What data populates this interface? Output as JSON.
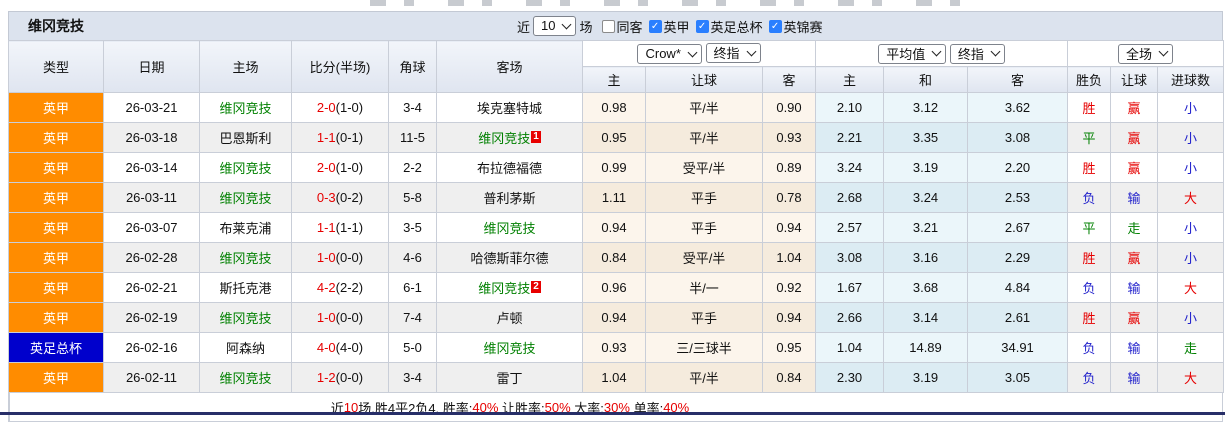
{
  "palette": {
    "league_orange": "#ff8c00",
    "cup_blue": "#0000cc",
    "team_green": "#008000",
    "red": "#e60000",
    "green": "#008000",
    "blue": "#2323cc",
    "check_blue": "#2a7fff",
    "titlebar": "#dce3ee",
    "bottom_line": "#272e68"
  },
  "header": {
    "team_title": "维冈竞技",
    "recent_prefix": "近",
    "recent_value": "10",
    "recent_suffix": "场",
    "checkboxes": [
      {
        "label": "同客",
        "checked": false
      },
      {
        "label": "英甲",
        "checked": true
      },
      {
        "label": "英足总杯",
        "checked": true
      },
      {
        "label": "英锦赛",
        "checked": true
      }
    ]
  },
  "selectors": {
    "bookmaker": "Crow*",
    "final1": "终指",
    "average": "平均值",
    "final2": "终指",
    "scope": "全场"
  },
  "columns": [
    "类型",
    "日期",
    "主场",
    "比分(半场)",
    "角球",
    "客场",
    "主",
    "让球",
    "客",
    "主",
    "和",
    "客",
    "胜负",
    "让球",
    "进球数"
  ],
  "rows": [
    {
      "league": "英甲",
      "league_color": "orange",
      "date": "26-03-21",
      "home": {
        "name": "维冈竞技",
        "highlight": true
      },
      "score": {
        "full": "2-0",
        "half": "(1-0)"
      },
      "corners": "3-4",
      "away": {
        "name": "埃克塞特城",
        "highlight": false,
        "badge": ""
      },
      "crow": {
        "home": "0.98",
        "handicap": "平/半",
        "away": "0.90"
      },
      "avg": {
        "home": "2.10",
        "draw": "3.12",
        "away": "3.62"
      },
      "outcome": {
        "text": "胜",
        "color": "red"
      },
      "handicap_outcome": {
        "text": "赢",
        "color": "red"
      },
      "goals_outcome": {
        "text": "小",
        "color": "blue"
      }
    },
    {
      "league": "英甲",
      "league_color": "orange",
      "date": "26-03-18",
      "home": {
        "name": "巴恩斯利",
        "highlight": false
      },
      "score": {
        "full": "1-1",
        "half": "(0-1)"
      },
      "corners": "11-5",
      "away": {
        "name": "维冈竞技",
        "highlight": true,
        "badge": "1"
      },
      "crow": {
        "home": "0.95",
        "handicap": "平/半",
        "away": "0.93"
      },
      "avg": {
        "home": "2.21",
        "draw": "3.35",
        "away": "3.08"
      },
      "outcome": {
        "text": "平",
        "color": "green"
      },
      "handicap_outcome": {
        "text": "赢",
        "color": "red"
      },
      "goals_outcome": {
        "text": "小",
        "color": "blue"
      }
    },
    {
      "league": "英甲",
      "league_color": "orange",
      "date": "26-03-14",
      "home": {
        "name": "维冈竞技",
        "highlight": true
      },
      "score": {
        "full": "2-0",
        "half": "(1-0)"
      },
      "corners": "2-2",
      "away": {
        "name": "布拉德福德",
        "highlight": false,
        "badge": ""
      },
      "crow": {
        "home": "0.99",
        "handicap": "受平/半",
        "away": "0.89"
      },
      "avg": {
        "home": "3.24",
        "draw": "3.19",
        "away": "2.20"
      },
      "outcome": {
        "text": "胜",
        "color": "red"
      },
      "handicap_outcome": {
        "text": "赢",
        "color": "red"
      },
      "goals_outcome": {
        "text": "小",
        "color": "blue"
      }
    },
    {
      "league": "英甲",
      "league_color": "orange",
      "date": "26-03-11",
      "home": {
        "name": "维冈竞技",
        "highlight": true
      },
      "score": {
        "full": "0-3",
        "half": "(0-2)"
      },
      "corners": "5-8",
      "away": {
        "name": "普利茅斯",
        "highlight": false,
        "badge": ""
      },
      "crow": {
        "home": "1.11",
        "handicap": "平手",
        "away": "0.78"
      },
      "avg": {
        "home": "2.68",
        "draw": "3.24",
        "away": "2.53"
      },
      "outcome": {
        "text": "负",
        "color": "blue"
      },
      "handicap_outcome": {
        "text": "输",
        "color": "blue"
      },
      "goals_outcome": {
        "text": "大",
        "color": "red"
      }
    },
    {
      "league": "英甲",
      "league_color": "orange",
      "date": "26-03-07",
      "home": {
        "name": "布莱克浦",
        "highlight": false
      },
      "score": {
        "full": "1-1",
        "half": "(1-1)"
      },
      "corners": "3-5",
      "away": {
        "name": "维冈竞技",
        "highlight": true,
        "badge": ""
      },
      "crow": {
        "home": "0.94",
        "handicap": "平手",
        "away": "0.94"
      },
      "avg": {
        "home": "2.57",
        "draw": "3.21",
        "away": "2.67"
      },
      "outcome": {
        "text": "平",
        "color": "green"
      },
      "handicap_outcome": {
        "text": "走",
        "color": "green"
      },
      "goals_outcome": {
        "text": "小",
        "color": "blue"
      }
    },
    {
      "league": "英甲",
      "league_color": "orange",
      "date": "26-02-28",
      "home": {
        "name": "维冈竞技",
        "highlight": true
      },
      "score": {
        "full": "1-0",
        "half": "(0-0)"
      },
      "corners": "4-6",
      "away": {
        "name": "哈德斯菲尔德",
        "highlight": false,
        "badge": ""
      },
      "crow": {
        "home": "0.84",
        "handicap": "受平/半",
        "away": "1.04"
      },
      "avg": {
        "home": "3.08",
        "draw": "3.16",
        "away": "2.29"
      },
      "outcome": {
        "text": "胜",
        "color": "red"
      },
      "handicap_outcome": {
        "text": "赢",
        "color": "red"
      },
      "goals_outcome": {
        "text": "小",
        "color": "blue"
      }
    },
    {
      "league": "英甲",
      "league_color": "orange",
      "date": "26-02-21",
      "home": {
        "name": "斯托克港",
        "highlight": false
      },
      "score": {
        "full": "4-2",
        "half": "(2-2)"
      },
      "corners": "6-1",
      "away": {
        "name": "维冈竞技",
        "highlight": true,
        "badge": "2"
      },
      "crow": {
        "home": "0.96",
        "handicap": "半/一",
        "away": "0.92"
      },
      "avg": {
        "home": "1.67",
        "draw": "3.68",
        "away": "4.84"
      },
      "outcome": {
        "text": "负",
        "color": "blue"
      },
      "handicap_outcome": {
        "text": "输",
        "color": "blue"
      },
      "goals_outcome": {
        "text": "大",
        "color": "red"
      }
    },
    {
      "league": "英甲",
      "league_color": "orange",
      "date": "26-02-19",
      "home": {
        "name": "维冈竞技",
        "highlight": true
      },
      "score": {
        "full": "1-0",
        "half": "(0-0)"
      },
      "corners": "7-4",
      "away": {
        "name": "卢顿",
        "highlight": false,
        "badge": ""
      },
      "crow": {
        "home": "0.94",
        "handicap": "平手",
        "away": "0.94"
      },
      "avg": {
        "home": "2.66",
        "draw": "3.14",
        "away": "2.61"
      },
      "outcome": {
        "text": "胜",
        "color": "red"
      },
      "handicap_outcome": {
        "text": "赢",
        "color": "red"
      },
      "goals_outcome": {
        "text": "小",
        "color": "blue"
      }
    },
    {
      "league": "英足总杯",
      "league_color": "blue",
      "date": "26-02-16",
      "home": {
        "name": "阿森纳",
        "highlight": false
      },
      "score": {
        "full": "4-0",
        "half": "(4-0)"
      },
      "corners": "5-0",
      "away": {
        "name": "维冈竞技",
        "highlight": true,
        "badge": ""
      },
      "crow": {
        "home": "0.93",
        "handicap": "三/三球半",
        "away": "0.95"
      },
      "avg": {
        "home": "1.04",
        "draw": "14.89",
        "away": "34.91"
      },
      "outcome": {
        "text": "负",
        "color": "blue"
      },
      "handicap_outcome": {
        "text": "输",
        "color": "blue"
      },
      "goals_outcome": {
        "text": "走",
        "color": "green"
      }
    },
    {
      "league": "英甲",
      "league_color": "orange",
      "date": "26-02-11",
      "home": {
        "name": "维冈竞技",
        "highlight": true
      },
      "score": {
        "full": "1-2",
        "half": "(0-0)"
      },
      "corners": "3-4",
      "away": {
        "name": "雷丁",
        "highlight": false,
        "badge": ""
      },
      "crow": {
        "home": "1.04",
        "handicap": "平/半",
        "away": "0.84"
      },
      "avg": {
        "home": "2.30",
        "draw": "3.19",
        "away": "3.05"
      },
      "outcome": {
        "text": "负",
        "color": "blue"
      },
      "handicap_outcome": {
        "text": "输",
        "color": "blue"
      },
      "goals_outcome": {
        "text": "大",
        "color": "red"
      }
    }
  ],
  "footer_segments": [
    {
      "text": "近",
      "color": "black"
    },
    {
      "text": "10",
      "color": "red"
    },
    {
      "text": "场,胜4平2负4, 胜率:",
      "color": "black"
    },
    {
      "text": "40%",
      "color": "red"
    },
    {
      "text": " 让胜率:",
      "color": "black"
    },
    {
      "text": "50%",
      "color": "red"
    },
    {
      "text": " 大率:",
      "color": "black"
    },
    {
      "text": "30%",
      "color": "red"
    },
    {
      "text": " 单率:",
      "color": "black"
    },
    {
      "text": "40%",
      "color": "red"
    }
  ]
}
